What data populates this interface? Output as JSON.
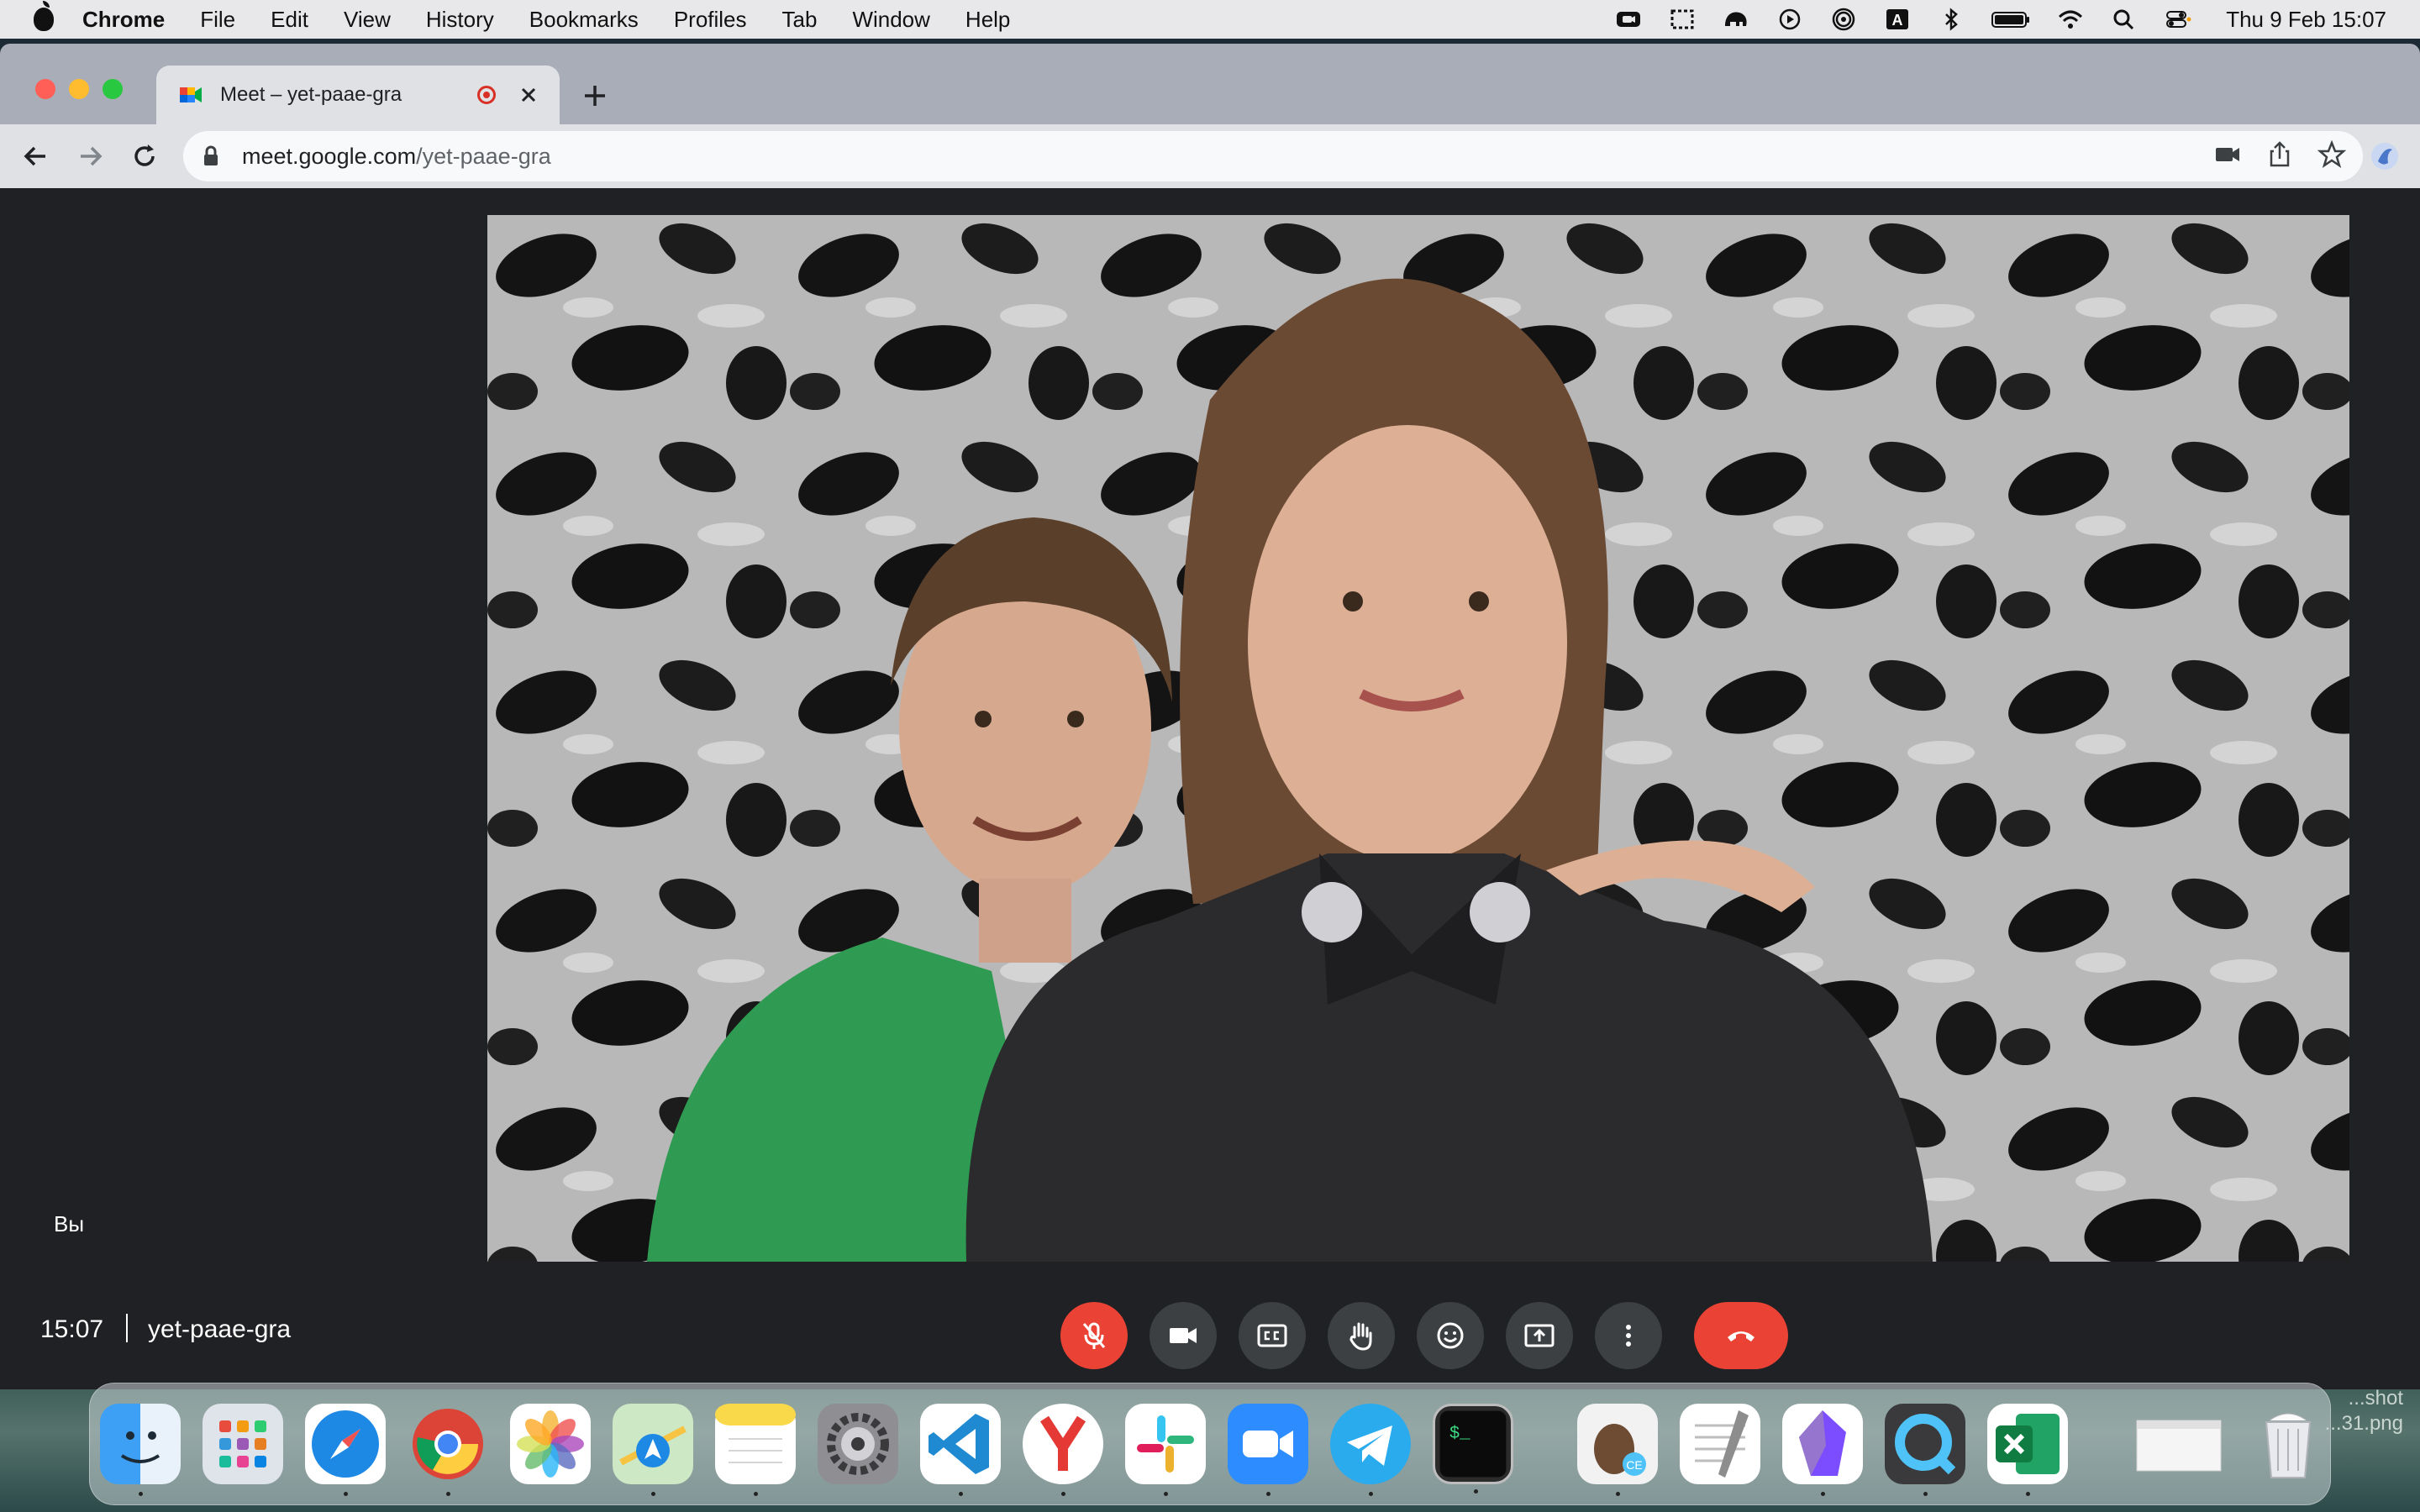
{
  "menubar": {
    "app_name": "Chrome",
    "items": [
      "File",
      "Edit",
      "View",
      "History",
      "Bookmarks",
      "Profiles",
      "Tab",
      "Window",
      "Help"
    ],
    "status_icons": [
      "camera-status-icon",
      "screenshot-icon",
      "elephant-icon",
      "play-icon",
      "airdrop-icon",
      "input-source-icon",
      "bluetooth-icon",
      "battery-icon",
      "wifi-icon",
      "spotlight-icon",
      "control-center-icon"
    ],
    "input_source": "A",
    "datetime": "Thu 9 Feb  15:07"
  },
  "browser": {
    "tab": {
      "title": "Meet – yet-paae-gra",
      "recording": true
    },
    "url_host": "meet.google.com",
    "url_path": "/yet-paae-gra"
  },
  "meet": {
    "self_label": "Вы",
    "time": "15:07",
    "meeting_code": "yet-paae-gra",
    "controls": [
      {
        "name": "mic-toggle",
        "state": "muted"
      },
      {
        "name": "camera-toggle"
      },
      {
        "name": "captions-toggle"
      },
      {
        "name": "raise-hand"
      },
      {
        "name": "reactions"
      },
      {
        "name": "present-screen"
      },
      {
        "name": "more-options"
      },
      {
        "name": "leave-call"
      }
    ]
  },
  "dock": {
    "apps": [
      "Finder",
      "Launchpad",
      "Safari",
      "Chrome",
      "Photos",
      "Maps",
      "Notes",
      "System Settings",
      "VS Code",
      "Yandex Browser",
      "Slack",
      "Zoom",
      "Telegram",
      "Terminal"
    ],
    "extra_apps": [
      "Cheat Engine",
      "TextEdit",
      "Obsidian",
      "QuickTime Player",
      "Excel"
    ],
    "trailing": [
      "Screenshot file",
      "Trash"
    ],
    "terminal_glyph": "$_"
  },
  "desktop": {
    "wallpaper_file_label": "...shot\n...31.png"
  }
}
